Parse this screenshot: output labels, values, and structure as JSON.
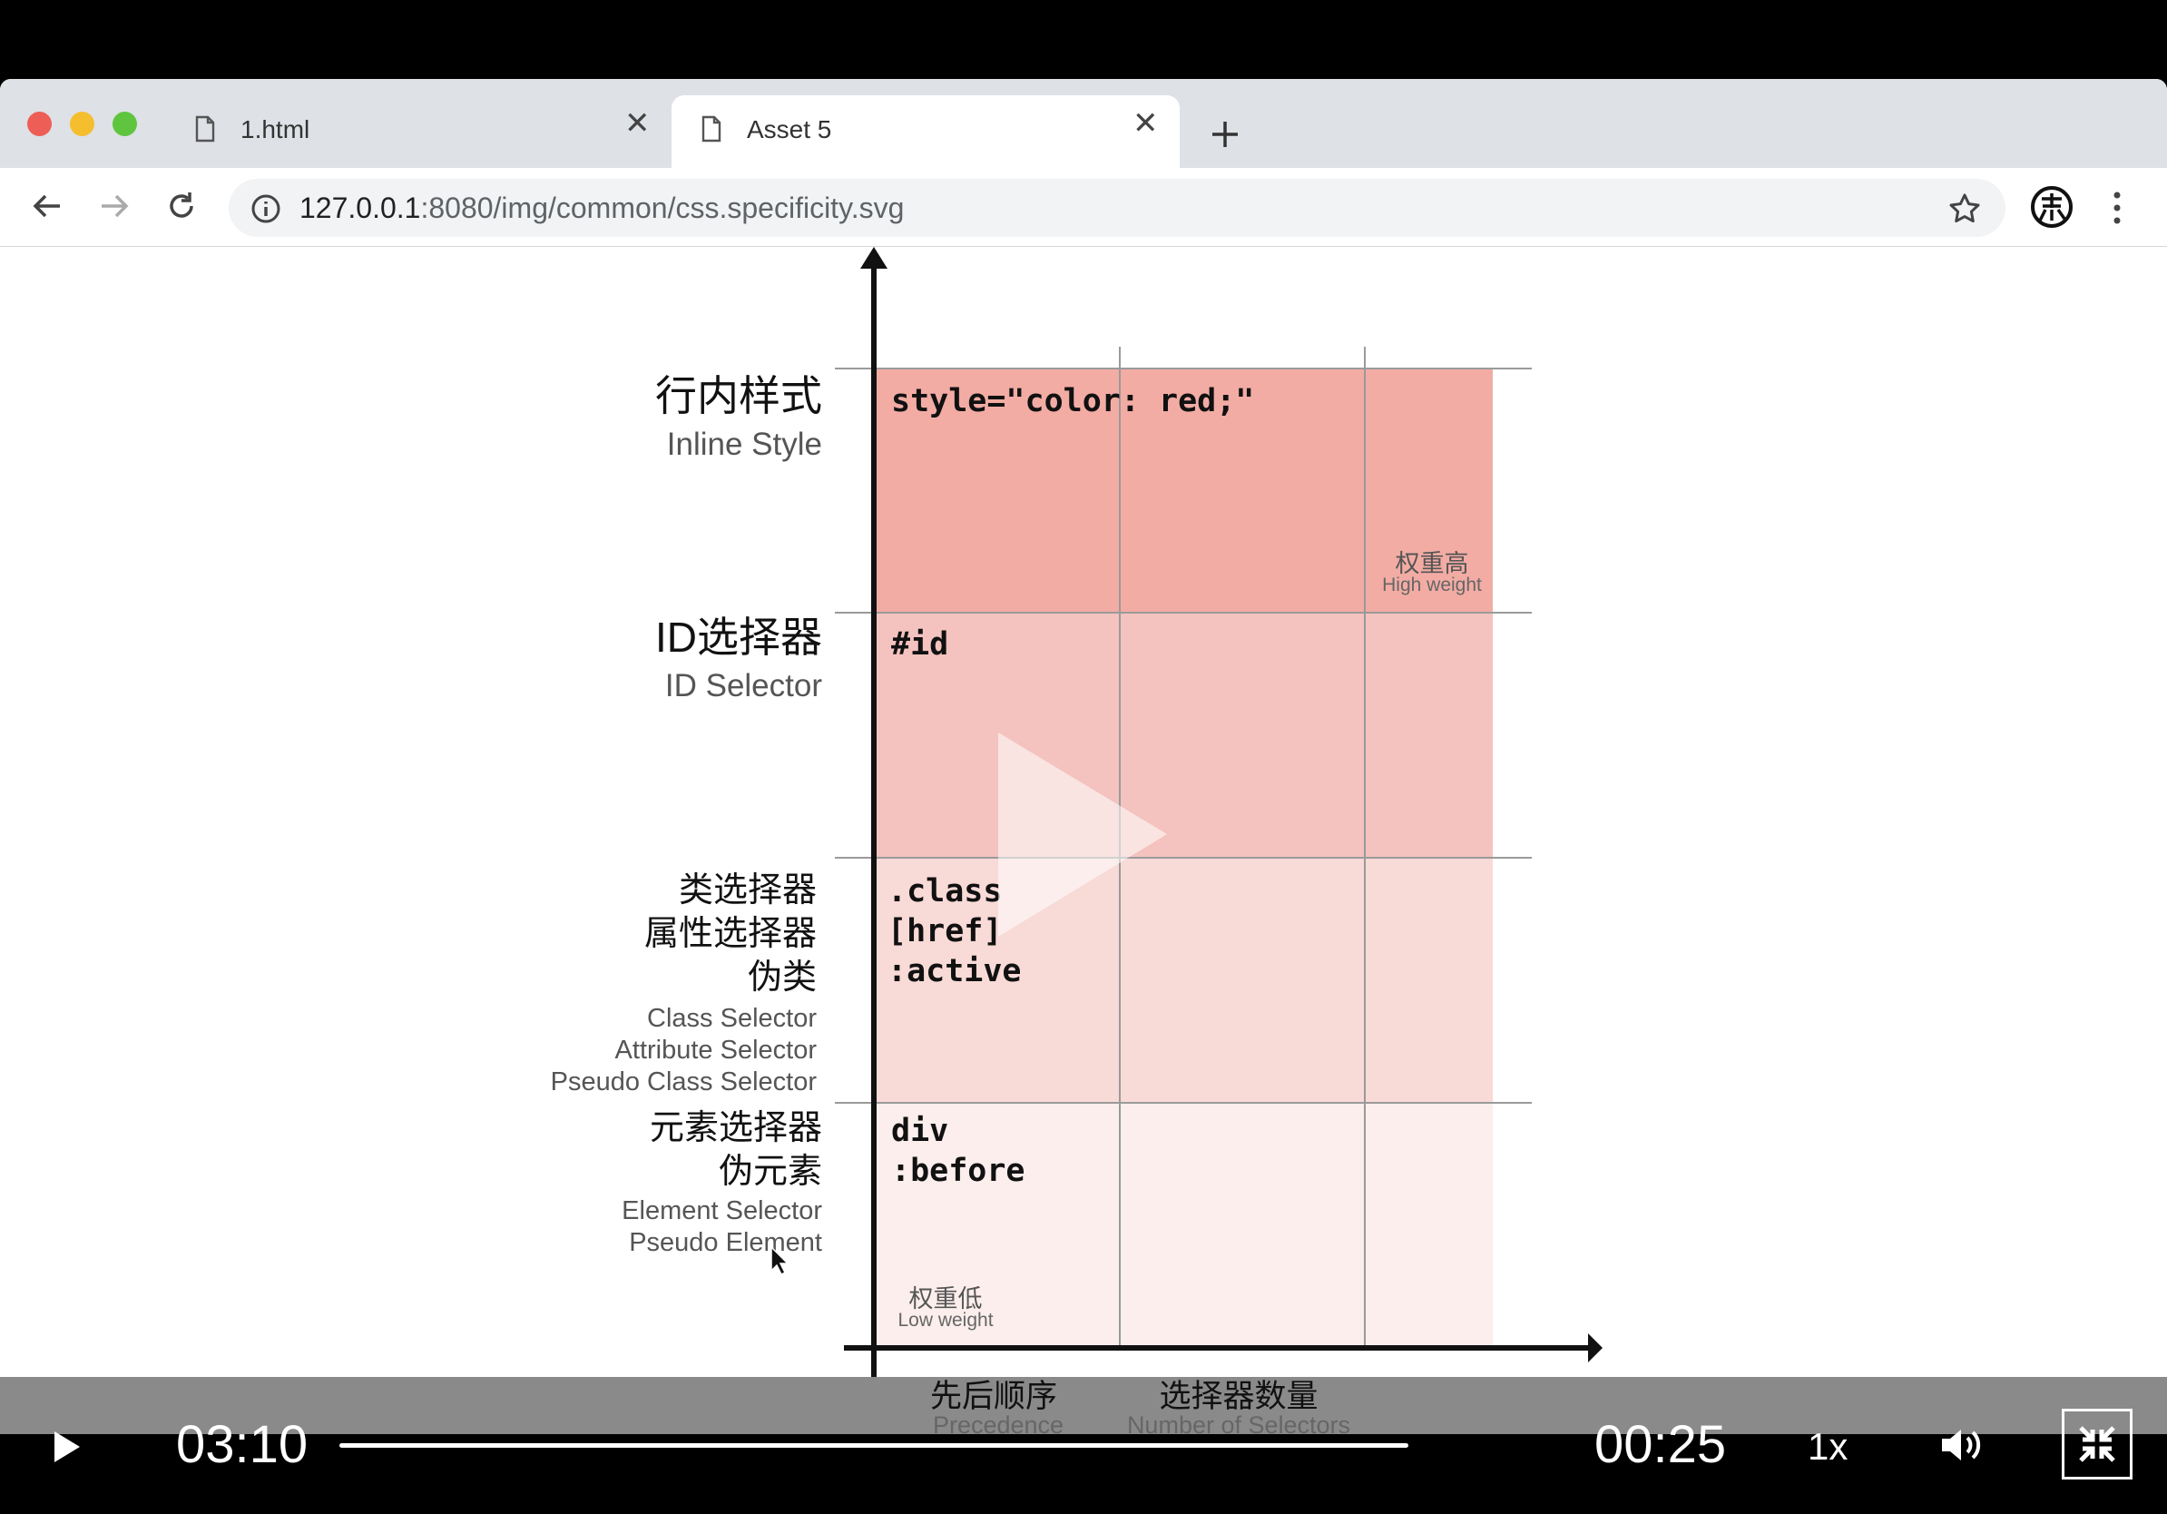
{
  "browser": {
    "tabs": [
      {
        "title": "1.html",
        "active": false
      },
      {
        "title": "Asset 5",
        "active": true
      }
    ],
    "new_tab_icon": "plus-icon",
    "url_host": "127.0.0.1",
    "url_rest": ":8080/img/common/css.specificity.svg",
    "traffic_lights": {
      "close": "#ed5e57",
      "minimize": "#f5be2f",
      "maximize": "#5fc53f"
    }
  },
  "diagram": {
    "rows": [
      {
        "zh": [
          "行内样式"
        ],
        "en": [
          "Inline Style"
        ],
        "code": [
          "style=\"color: red;\""
        ],
        "color": "#f2aca4"
      },
      {
        "zh": [
          "ID选择器"
        ],
        "en": [
          "ID Selector"
        ],
        "code": [
          "#id"
        ],
        "color": "#f4c3bf"
      },
      {
        "zh": [
          "类选择器",
          "属性选择器",
          "伪类"
        ],
        "en": [
          "Class Selector",
          "Attribute Selector",
          "Pseudo Class Selector"
        ],
        "code": [
          ".class",
          "[href]",
          ":active"
        ],
        "color": "#f8dad7"
      },
      {
        "zh": [
          "元素选择器",
          "伪元素"
        ],
        "en": [
          "Element Selector",
          "Pseudo Element"
        ],
        "code": [
          "div",
          ":before"
        ],
        "color": "#fbeeec"
      }
    ],
    "high_weight": {
      "zh": "权重高",
      "en": "High weight"
    },
    "low_weight": {
      "zh": "权重低",
      "en": "Low weight"
    },
    "x_axis": [
      {
        "zh": "先后顺序",
        "en": "Precedence"
      },
      {
        "zh": "选择器数量",
        "en": "Number of Selectors"
      }
    ]
  },
  "player": {
    "elapsed": "03:10",
    "remaining": "00:25",
    "speed": "1x",
    "progress": 1.0
  }
}
